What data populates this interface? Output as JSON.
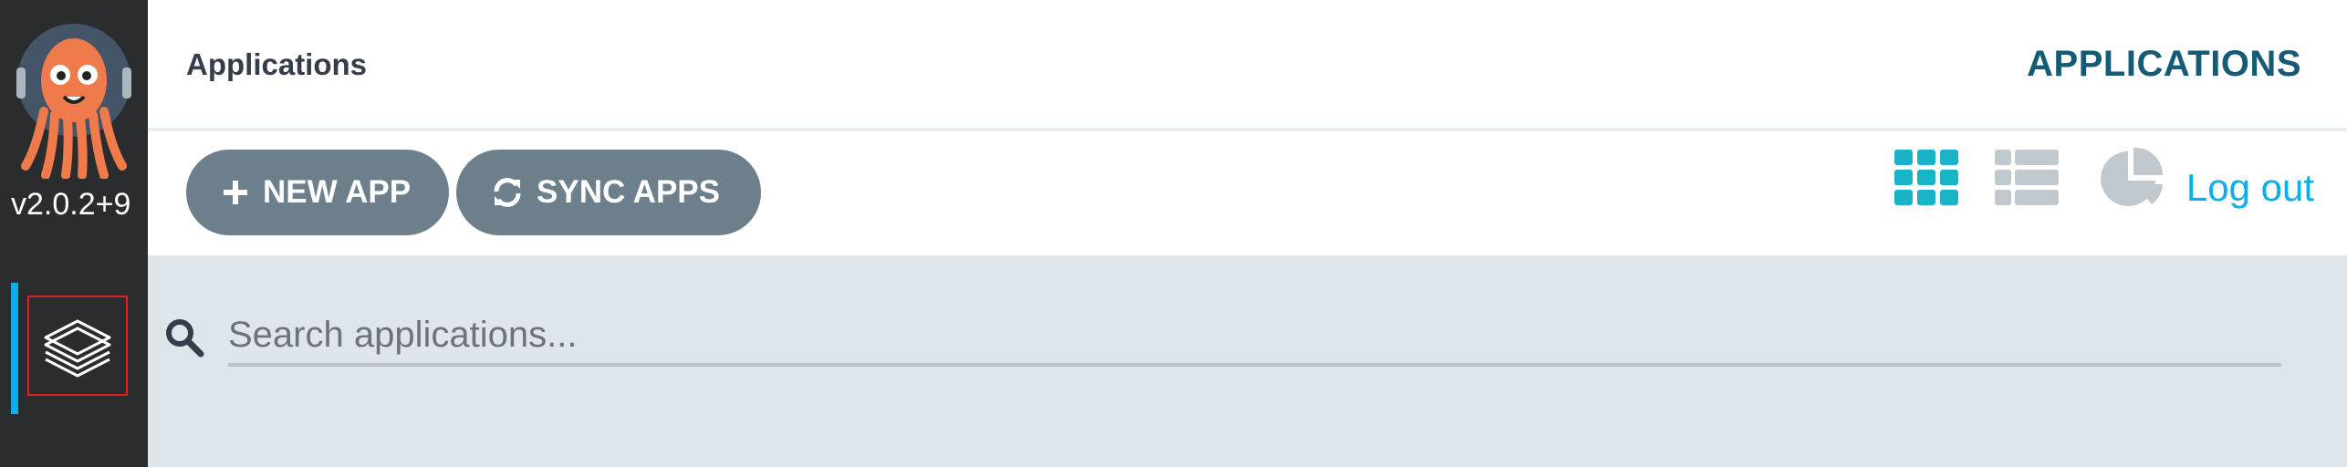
{
  "sidebar": {
    "version": "v2.0.2+9",
    "logo_icon": "argo-octopus-logo",
    "nav_items": [
      {
        "icon": "layers-icon",
        "active": true
      }
    ],
    "accent_color": "#0dadea"
  },
  "header": {
    "title": "Applications",
    "nav_label": "APPLICATIONS"
  },
  "toolbar": {
    "new_app_label": "NEW APP",
    "sync_apps_label": "SYNC APPS",
    "views": [
      {
        "icon": "tiles-view-icon",
        "active": true
      },
      {
        "icon": "list-view-icon",
        "active": false
      },
      {
        "icon": "summary-pie-icon",
        "active": false
      }
    ],
    "logout_label": "Log out"
  },
  "search": {
    "placeholder": "Search applications...",
    "value": ""
  },
  "colors": {
    "sidebar_bg": "#2b2c2d",
    "button_bg": "#6d7f8b",
    "brand_teal": "#165b75",
    "link_blue": "#0dadea",
    "search_bg": "#dee6eb"
  }
}
